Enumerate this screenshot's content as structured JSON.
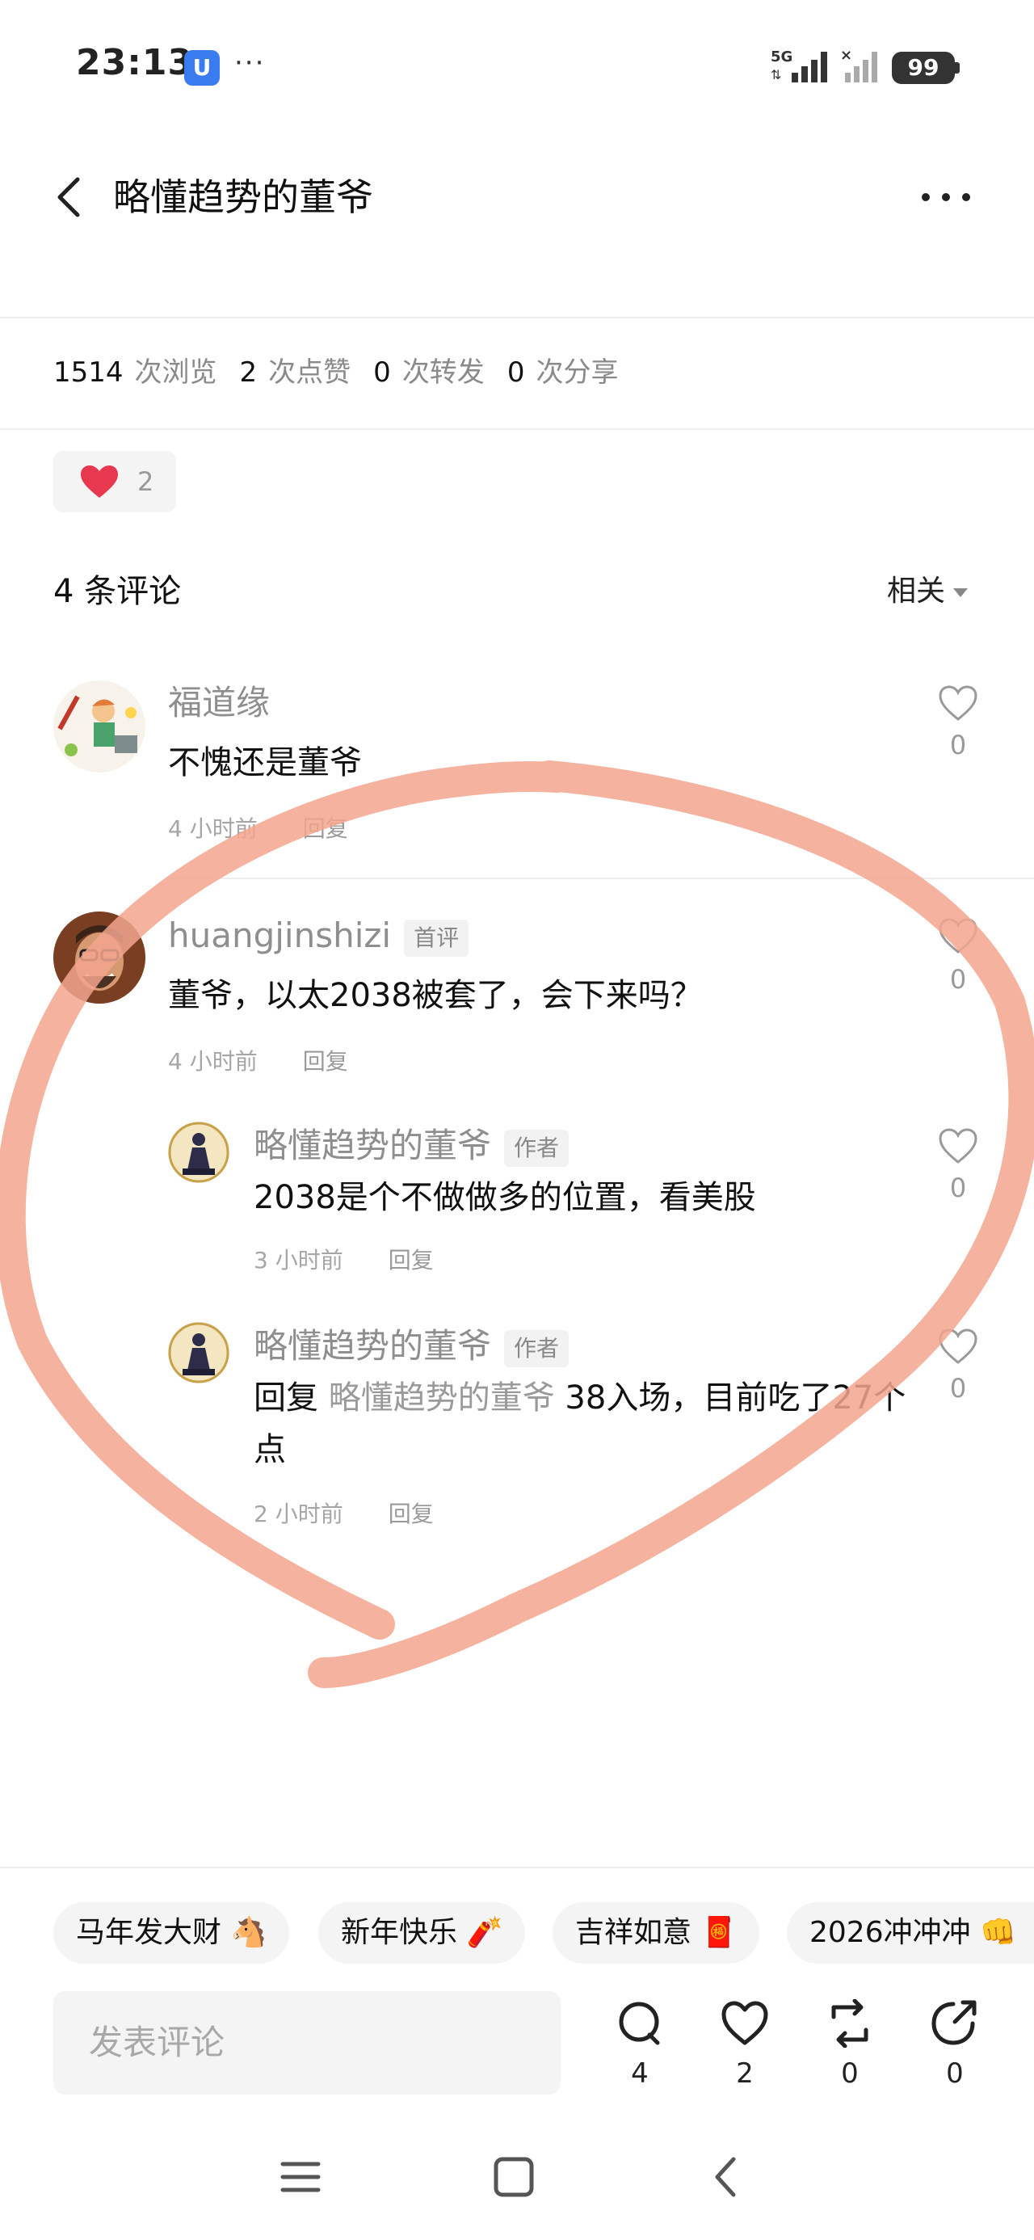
{
  "status_bar": {
    "time": "23:13",
    "app_icon_glyph": "U",
    "more": "···",
    "battery": "99"
  },
  "header": {
    "title": "略懂趋势的董爷"
  },
  "stats": {
    "views": "1514",
    "views_label": "次浏览",
    "likes": "2",
    "likes_label": "次点赞",
    "reposts": "0",
    "reposts_label": "次转发",
    "shares": "0",
    "shares_label": "次分享"
  },
  "like_chip": {
    "count": "2"
  },
  "comments_section": {
    "title": "4 条评论",
    "sort_label": "相关"
  },
  "comments": [
    {
      "author": "福道缘",
      "text": "不愧还是董爷",
      "time": "4 小时前",
      "reply_label": "回复",
      "likes": "0"
    },
    {
      "author": "huangjinshizi",
      "tag": "首评",
      "text": "董爷，以太2038被套了，会下来吗？",
      "time": "4 小时前",
      "reply_label": "回复",
      "likes": "0",
      "replies": [
        {
          "author": "略懂趋势的董爷",
          "tag": "作者",
          "text": "2038是个不做做多的位置，看美股",
          "time": "3 小时前",
          "reply_label": "回复",
          "likes": "0"
        },
        {
          "author": "略懂趋势的董爷",
          "tag": "作者",
          "reply_prefix": "回复 ",
          "reply_to": "略懂趋势的董爷",
          "text": " 38入场，目前吃了27个点",
          "time": "2 小时前",
          "reply_label": "回复",
          "likes": "0"
        }
      ]
    }
  ],
  "quick_replies": [
    "马年发大财 🐴",
    "新年快乐 🧨",
    "吉祥如意 🧧",
    "2026冲冲冲 👊"
  ],
  "composer": {
    "placeholder": "发表评论",
    "comment_count": "4",
    "like_count": "2",
    "repost_count": "0",
    "share_count": "0"
  },
  "colors": {
    "accent_heart": "#e8384f",
    "annotation": "#f2a58e",
    "muted_text": "#8e8e8e"
  },
  "icons": [
    "back-arrow-icon",
    "more-dots-icon",
    "heart-filled-icon",
    "heart-outline-icon",
    "comment-bubble-icon",
    "repost-icon",
    "share-icon",
    "menu-icon",
    "home-square-icon",
    "nav-back-icon",
    "signal-icon",
    "battery-icon"
  ]
}
